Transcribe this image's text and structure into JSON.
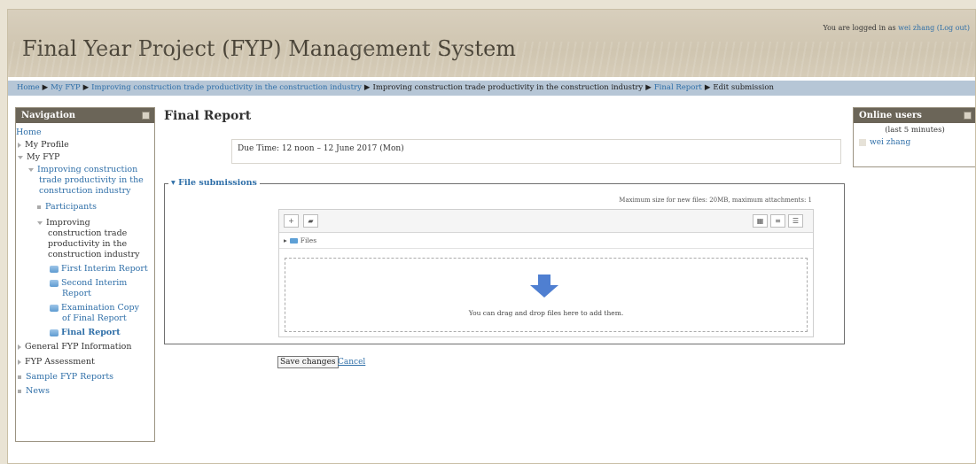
{
  "header": {
    "site_title": "Final Year Project (FYP) Management System",
    "login_prefix": "You are logged in as ",
    "login_user": "wei zhang",
    "logout": "(Log out)"
  },
  "breadcrumb": {
    "home": "Home",
    "myfyp": "My FYP",
    "course": "Improving construction trade productivity in the construction industry",
    "section": "Improving construction trade productivity in the construction industry",
    "final_report": "Final Report",
    "current": "Edit submission"
  },
  "navigation": {
    "title": "Navigation",
    "home": "Home",
    "my_profile": "My Profile",
    "my_fyp": "My FYP",
    "course_line1": "Improving construction",
    "course_line2": "trade productivity in the",
    "course_line3": "construction industry",
    "participants": "Participants",
    "section_line1": "Improving",
    "section_line2": "construction trade",
    "section_line3": "productivity in the",
    "section_line4": "construction industry",
    "first_interim": "First Interim Report",
    "second_interim_1": "Second Interim",
    "second_interim_2": "Report",
    "exam_copy_1": "Examination Copy",
    "exam_copy_2": "of Final Report",
    "final_report": "Final Report",
    "general_info": "General FYP Information",
    "assessment": "FYP Assessment",
    "sample_reports": "Sample FYP Reports",
    "news": "News"
  },
  "online": {
    "title": "Online users",
    "subtitle": "(last 5 minutes)",
    "user": "wei zhang"
  },
  "main": {
    "title": "Final Report",
    "due_time": "Due Time: 12 noon – 12 June 2017 (Mon)",
    "legend": "File submissions",
    "max_size": "Maximum size for new files: 20MB, maximum attachments: 1",
    "files_label": "Files",
    "drop_text": "You can drag and drop files here to add them.",
    "save_label": "Save changes",
    "cancel_label": "Cancel"
  }
}
